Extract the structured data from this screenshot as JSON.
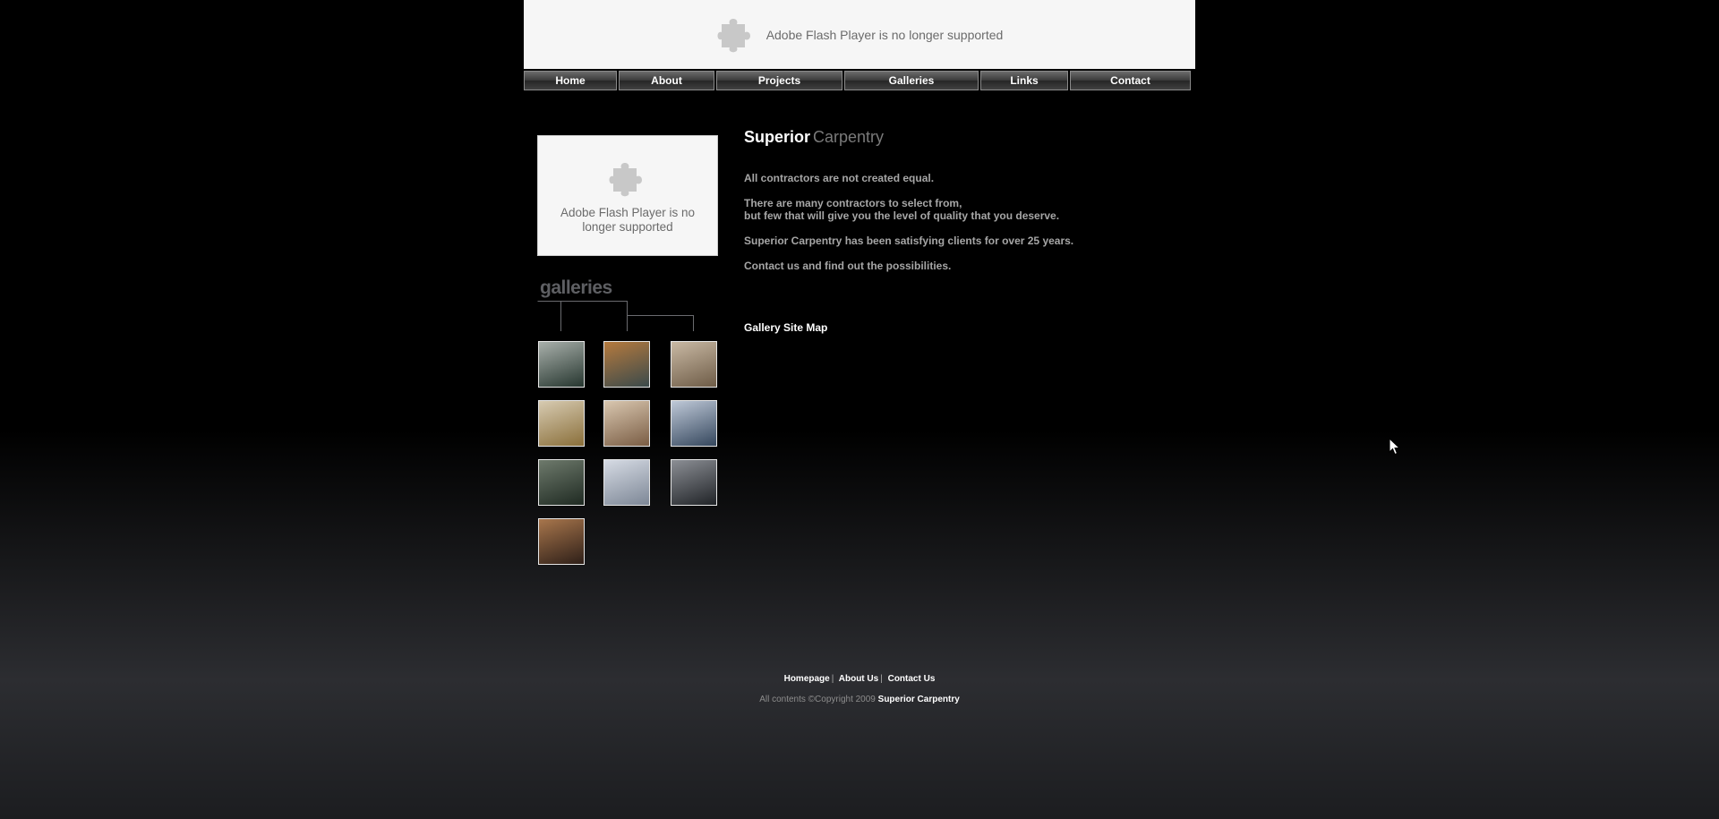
{
  "flash": {
    "top_message": "Adobe Flash Player is no longer supported",
    "side_message": "Adobe Flash Player is no longer supported",
    "icon": "puzzle-icon"
  },
  "nav": {
    "items": [
      {
        "label": "Home"
      },
      {
        "label": "About"
      },
      {
        "label": "Projects"
      },
      {
        "label": "Galleries"
      },
      {
        "label": "Links"
      },
      {
        "label": "Contact"
      }
    ]
  },
  "main": {
    "title_bold": "Superior",
    "title_light": "Carpentry",
    "p1": "All contractors are not created equal.",
    "p2a": "There are many contractors to select from,",
    "p2b": "but few that will give you the level of quality that you deserve.",
    "p3": "Superior Carpentry has been satisfying clients for over 25 years.",
    "p4": "Contact us and find out the possibilities.",
    "sitemap": "Gallery Site Map"
  },
  "sidebar": {
    "galleries_label": "galleries"
  },
  "thumbnails": [
    {
      "colors": [
        "#a9b0ab",
        "#26362f"
      ]
    },
    {
      "colors": [
        "#b57a3e",
        "#3b4a4b"
      ]
    },
    {
      "colors": [
        "#c9b9a4",
        "#6e5c47"
      ]
    },
    {
      "colors": [
        "#d7cbb2",
        "#8a6f3a"
      ]
    },
    {
      "colors": [
        "#d9c7b0",
        "#7a5d44"
      ]
    },
    {
      "colors": [
        "#bfc9d8",
        "#35475d"
      ]
    },
    {
      "colors": [
        "#6e7a6c",
        "#1f2a22"
      ]
    },
    {
      "colors": [
        "#d6dbe4",
        "#7d8796"
      ]
    },
    {
      "colors": [
        "#8c8f95",
        "#202327"
      ]
    },
    {
      "colors": [
        "#a8764c",
        "#2e1f18"
      ]
    }
  ],
  "footer": {
    "link_home": "Homepage",
    "link_about": "About Us",
    "link_contact": "Contact Us",
    "copyright": "All contents ©Copyright 2009",
    "company": "Superior Carpentry"
  }
}
